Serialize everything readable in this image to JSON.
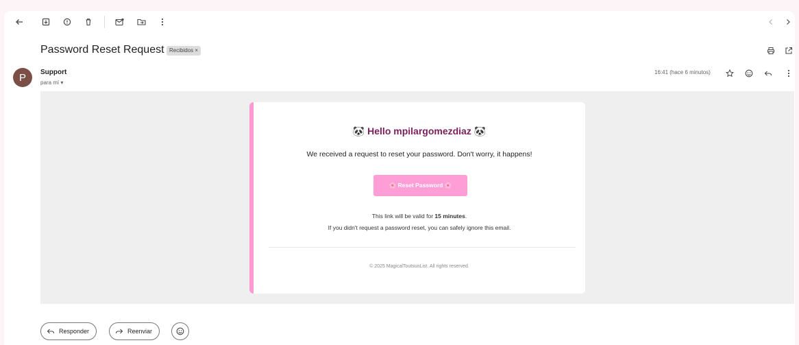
{
  "email": {
    "subject": "Password Reset Request",
    "label": "Recibidos ×",
    "sender_initial": "P",
    "sender_name": "Support",
    "recipient": "para mí ▾",
    "timestamp": "16:41 (hace 6 minutos)"
  },
  "card": {
    "greeting": "🐼 Hello mpilargomezdiaz 🐼",
    "message": "We received a request to reset your password. Don't worry, it happens!",
    "button_label": "🌸 Reset Password 🌸",
    "validity_prefix": "This link will be valid for ",
    "validity_value": "15 minutes",
    "validity_suffix": ".",
    "ignore_note": "If you didn't request a password reset, you can safely ignore this email.",
    "footer": "© 2025 MagicalToutsunList. All rights reserved."
  },
  "actions": {
    "reply_label": "Responder",
    "forward_label": "Reenviar"
  },
  "colors": {
    "accent_pink": "#ff9ad5",
    "button_pink": "#ff9ed6",
    "greeting_color": "#7a1f5c",
    "avatar_bg": "#7b4f45"
  },
  "icons": {
    "toolbar": [
      "back-arrow-icon",
      "archive-icon",
      "report-spam-icon",
      "delete-icon",
      "mark-unread-icon",
      "move-to-icon",
      "more-vert-icon"
    ],
    "pagination": [
      "chevron-left-icon",
      "chevron-right-icon"
    ],
    "subject_actions": [
      "print-icon",
      "open-new-window-icon"
    ],
    "message_actions": [
      "star-icon",
      "emoji-icon",
      "reply-icon",
      "more-vert-icon"
    ]
  }
}
